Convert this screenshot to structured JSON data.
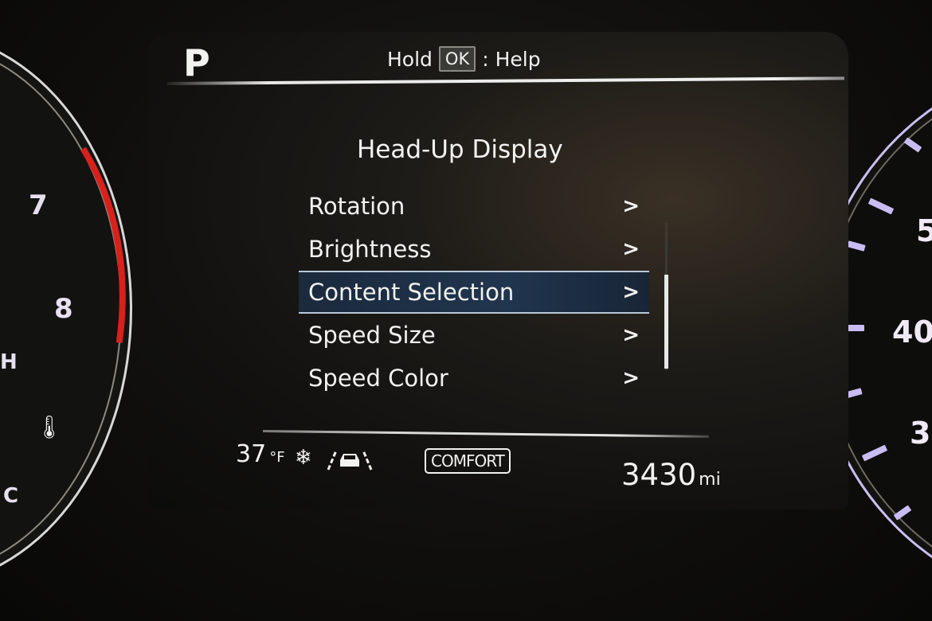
{
  "header": {
    "gear": "P",
    "help_prefix": "Hold",
    "help_button": "OK",
    "help_suffix": ": Help"
  },
  "menu": {
    "title": "Head-Up Display",
    "items": [
      {
        "label": "Rotation",
        "chevron": ">"
      },
      {
        "label": "Brightness",
        "chevron": ">"
      },
      {
        "label": "Content Selection",
        "chevron": ">",
        "selected": true
      },
      {
        "label": "Speed Size",
        "chevron": ">"
      },
      {
        "label": "Speed Color",
        "chevron": ">"
      }
    ]
  },
  "status_bar": {
    "temperature": "37",
    "temperature_unit": "°F",
    "snowflake_icon": "❄",
    "drive_mode": "COMFORT",
    "odometer": "3430",
    "odometer_unit": "mi"
  },
  "tachometer": {
    "labels": [
      "7",
      "8"
    ],
    "temp_labels": [
      "H",
      "C"
    ]
  },
  "speedometer": {
    "labels": [
      "5",
      "40",
      "3"
    ]
  }
}
